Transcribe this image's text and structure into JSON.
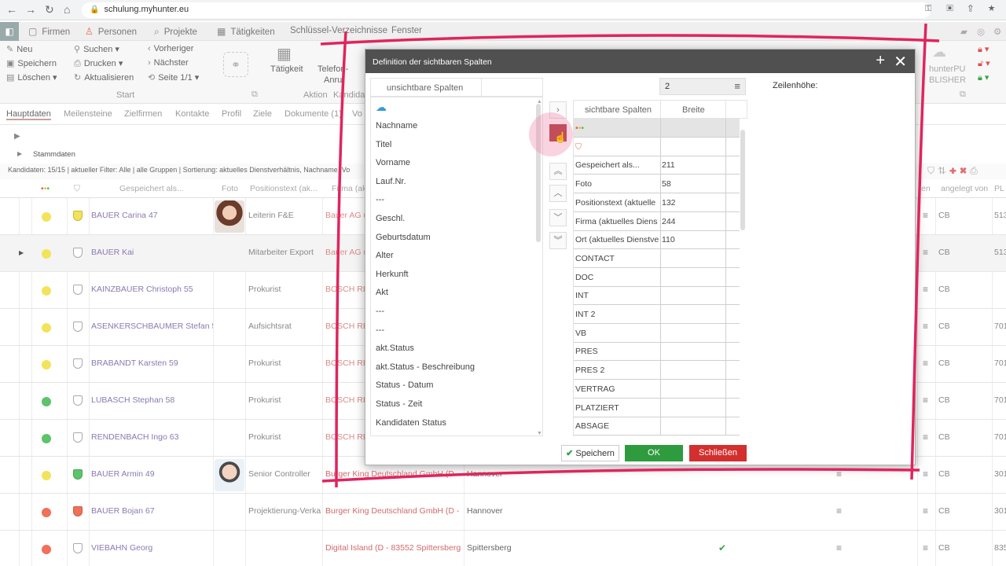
{
  "browser": {
    "url": "schulung.myhunter.eu"
  },
  "modules": [
    {
      "label": "Firmen"
    },
    {
      "label": "Personen"
    },
    {
      "label": "Projekte"
    },
    {
      "label": "Tätigkeiten"
    },
    {
      "label": "Schlüssel-Verzeichnisse"
    },
    {
      "label": "Fenster"
    }
  ],
  "ribbon": {
    "neu": "Neu",
    "speichern": "Speichern",
    "loeschen": "Löschen",
    "suchen": "Suchen",
    "drucken": "Drucken",
    "aktualisieren": "Aktualisieren",
    "vorheriger": "Vorheriger",
    "naechster": "Nächster",
    "seite": "Seite 1/1",
    "start_group": "Start",
    "taetigkeit": "Tätigkeit",
    "telefon1": "Telefon-",
    "telefon2": "Anruf",
    "aktion_group": "Aktion",
    "kandida": "Kandida",
    "publisher1": "hunterPU",
    "publisher2": "BLISHER"
  },
  "tabs": [
    "Hauptdaten",
    "Meilensteine",
    "Zielfirmen",
    "Kontakte",
    "Profil",
    "Ziele",
    "Dokumente (1)",
    "Vo"
  ],
  "breadcrumb": {
    "stammdaten": "Stammdaten"
  },
  "status_line": "Kandidaten: 15/15 | aktueller Filter: Alle | alle Gruppen | Sortierung: aktuelles Dienstverhältnis, Nachname, Vo",
  "grid": {
    "headers": {
      "gespeichert": "Gespeichert als...",
      "foto": "Foto",
      "position": "Positionstext (ak...",
      "firma": "Firma (ak",
      "en": "en",
      "angelegt": "angelegt von",
      "pl": "PL"
    },
    "rows": [
      {
        "name": "BAUER Carina 47",
        "position": "Leiterin F&E",
        "firm": "Bauer AG (",
        "city": "",
        "dot": "#f2e35a",
        "angelegt": "CB",
        "pl": "513",
        "shield": "yellow",
        "photo": "woman"
      },
      {
        "name": "BAUER Kai",
        "position": "Mitarbeiter Export",
        "firm": "Bauer AG (",
        "city": "",
        "dot": "#f2e35a",
        "angelegt": "CB",
        "pl": "513",
        "shield": "none",
        "selected": true
      },
      {
        "name": "KAINZBAUER Christoph 55",
        "position": "Prokurist",
        "firm": "BOSCH RE",
        "city": "",
        "dot": "#f2e35a",
        "angelegt": "CB",
        "pl": "",
        "shield": "none"
      },
      {
        "name": "ASENKERSCHBAUMER Stefan 56",
        "position": "Aufsichtsrat",
        "firm": "BOSCH RE",
        "city": "",
        "dot": "#f2e35a",
        "angelegt": "CB",
        "pl": "701",
        "shield": "none"
      },
      {
        "name": "BRABANDT Karsten 59",
        "position": "Prokurist",
        "firm": "BOSCH RE",
        "city": "",
        "dot": "#f2e35a",
        "angelegt": "CB",
        "pl": "701",
        "shield": "none"
      },
      {
        "name": "LUBASCH Stephan 58",
        "position": "Prokurist",
        "firm": "BOSCH RE",
        "city": "",
        "dot": "#5cc46a",
        "angelegt": "CB",
        "pl": "701",
        "shield": "none"
      },
      {
        "name": "RENDENBACH Ingo 63",
        "position": "Prokurist",
        "firm": "BOSCH RE",
        "city": "",
        "dot": "#5cc46a",
        "angelegt": "CB",
        "pl": "701",
        "shield": "none"
      },
      {
        "name": "BAUER Armin 49",
        "position": "Senior Controller",
        "firm": "Burger King Deutschland GmbH (D -",
        "city": "Hannover",
        "dot": "#f2e35a",
        "angelegt": "CB",
        "pl": "301",
        "shield": "green",
        "photo": "man"
      },
      {
        "name": "BAUER Bojan 67",
        "position": "Projektierung-Verka",
        "firm": "Burger King Deutschland GmbH (D -",
        "city": "Hannover",
        "dot": "#f0705a",
        "angelegt": "CB",
        "pl": "301",
        "shield": "red"
      },
      {
        "name": "VIEBAHN Georg",
        "position": "",
        "firm": "Digital Island (D - 83552 Spittersberg",
        "city": "Spittersberg",
        "dot": "#f0705a",
        "angelegt": "CB",
        "pl": "835",
        "shield": "none"
      }
    ]
  },
  "dialog": {
    "title": "Definition der sichtbaren Spalten",
    "invisible_header": "unsichtbare Spalten",
    "invisible_items": [
      "",
      "Nachname",
      "Titel",
      "Vorname",
      "Lauf.Nr.",
      "---",
      "Geschl.",
      "Geburtsdatum",
      "Alter",
      "Herkunft",
      "Akt",
      "---",
      "---",
      "akt.Status",
      "akt.Status - Beschreibung",
      "Status - Datum",
      "Status - Zeit",
      "Kandidaten Status"
    ],
    "row_height_value": "2",
    "row_height_label": "Zeilenhöhe:",
    "visible_header": "sichtbare Spalten",
    "width_header": "Breite",
    "visible_items": [
      {
        "name": "",
        "width": ""
      },
      {
        "name": "",
        "width": ""
      },
      {
        "name": "Gespeichert als...",
        "width": "211"
      },
      {
        "name": "Foto",
        "width": "58"
      },
      {
        "name": "Positionstext (aktuelle",
        "width": "132"
      },
      {
        "name": "Firma (aktuelles Diens",
        "width": "244"
      },
      {
        "name": "Ort (aktuelles Dienstve",
        "width": "110"
      },
      {
        "name": "CONTACT",
        "width": ""
      },
      {
        "name": "DOC",
        "width": ""
      },
      {
        "name": "INT",
        "width": ""
      },
      {
        "name": "INT 2",
        "width": ""
      },
      {
        "name": "VB",
        "width": ""
      },
      {
        "name": "PRES",
        "width": ""
      },
      {
        "name": "PRES 2",
        "width": ""
      },
      {
        "name": "VERTRAG",
        "width": ""
      },
      {
        "name": "PLATZIERT",
        "width": ""
      },
      {
        "name": "ABSAGE",
        "width": ""
      }
    ],
    "save_label": "Speichern",
    "ok_label": "OK",
    "close_label": "Schließen"
  },
  "colors": {
    "annotation": "#e0245e",
    "ok": "#2e9b3e",
    "close": "#d32f2f",
    "dialog_header": "#505050"
  }
}
